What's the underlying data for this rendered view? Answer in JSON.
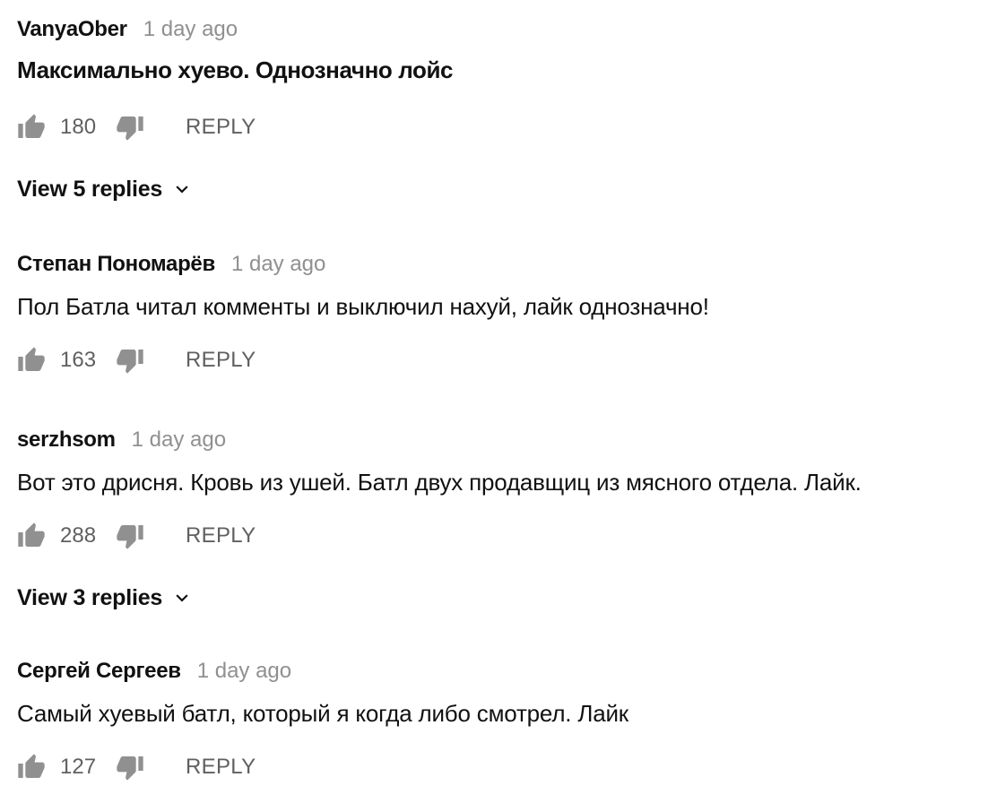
{
  "comments": [
    {
      "author": "VanyaOber",
      "time": "1 day ago",
      "text": "Максимально хуево. Однозначно лойс",
      "likes": "180",
      "reply_label": "REPLY",
      "view_replies": "View 5 replies"
    },
    {
      "author": "Степан Пономарёв",
      "time": "1 day ago",
      "text": "Пол Батла читал комменты и выключил нахуй, лайк однозначно!",
      "likes": "163",
      "reply_label": "REPLY"
    },
    {
      "author": "serzhsom",
      "time": "1 day ago",
      "text": "Вот это дрисня. Кровь из ушей. Батл двух продавщиц из мясного отдела. Лайк.",
      "likes": "288",
      "reply_label": "REPLY",
      "view_replies": "View 3 replies"
    },
    {
      "author": "Сергей Сергеев",
      "time": "1 day ago",
      "text": "Самый хуевый батл, который я когда либо смотрел. Лайк",
      "likes": "127",
      "reply_label": "REPLY"
    }
  ],
  "icons": {
    "like": "thumbs-up-icon",
    "dislike": "thumbs-down-icon",
    "expand": "chevron-down-icon"
  },
  "colors": {
    "text": "#111111",
    "secondary": "#909090",
    "icon": "#909090",
    "action_text": "#606060"
  }
}
